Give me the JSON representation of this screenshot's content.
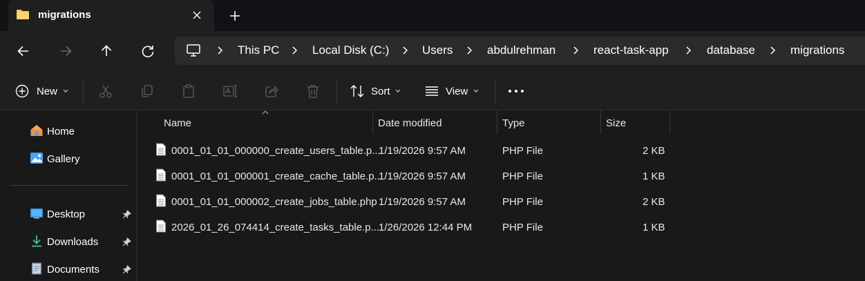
{
  "tab": {
    "title": "migrations",
    "close_icon": "close-icon",
    "new_tab_icon": "plus-icon"
  },
  "nav": {
    "back_icon": "arrow-left-icon",
    "forward_icon": "arrow-right-icon",
    "up_icon": "arrow-up-icon",
    "refresh_icon": "refresh-icon",
    "breadcrumbs": [
      "This PC",
      "Local Disk (C:)",
      "Users",
      "abdulrehman",
      "react-task-app",
      "database",
      "migrations"
    ]
  },
  "toolbar": {
    "new_label": "New",
    "sort_label": "Sort",
    "view_label": "View"
  },
  "sidebar": {
    "items": [
      {
        "label": "Home",
        "icon": "home-icon"
      },
      {
        "label": "Gallery",
        "icon": "gallery-icon"
      },
      {
        "label": "Desktop",
        "icon": "desktop-icon",
        "pinned": true
      },
      {
        "label": "Downloads",
        "icon": "downloads-icon",
        "pinned": true
      },
      {
        "label": "Documents",
        "icon": "documents-icon",
        "pinned": true
      }
    ]
  },
  "columns": [
    "Name",
    "Date modified",
    "Type",
    "Size"
  ],
  "files": [
    {
      "name": "0001_01_01_000000_create_users_table.p...",
      "date": "1/19/2026 9:57 AM",
      "type": "PHP File",
      "size": "2 KB"
    },
    {
      "name": "0001_01_01_000001_create_cache_table.p...",
      "date": "1/19/2026 9:57 AM",
      "type": "PHP File",
      "size": "1 KB"
    },
    {
      "name": "0001_01_01_000002_create_jobs_table.php",
      "date": "1/19/2026 9:57 AM",
      "type": "PHP File",
      "size": "2 KB"
    },
    {
      "name": "2026_01_26_074414_create_tasks_table.p...",
      "date": "1/26/2026 12:44 PM",
      "type": "PHP File",
      "size": "1 KB"
    }
  ],
  "colors": {
    "accent": "#4cc2ff",
    "folder": "#f8c85a",
    "background": "#191919",
    "titlebar": "#101216"
  }
}
